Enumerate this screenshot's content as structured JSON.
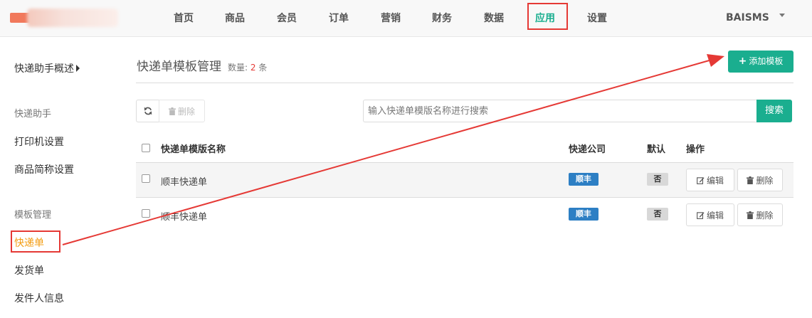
{
  "topnav": {
    "items": [
      "首页",
      "商品",
      "会员",
      "订单",
      "营销",
      "财务",
      "数据",
      "应用",
      "设置"
    ],
    "active_index": 7,
    "user": "BAISMS"
  },
  "sidebar": {
    "overview": "快递助手概述",
    "section1_title": "快递助手",
    "section1_items": [
      "打印机设置",
      "商品简称设置"
    ],
    "section2_title": "模板管理",
    "section2_items": [
      "快递单",
      "发货单",
      "发件人信息"
    ],
    "active_item": "快递单"
  },
  "main": {
    "title": "快递单模板管理",
    "count_label": "数量:",
    "count_value": "2",
    "count_unit": "条",
    "add_button": "添加模板",
    "delete_button": "删除",
    "search_placeholder": "输入快递单模版名称进行搜索",
    "search_value": "",
    "search_button": "搜索"
  },
  "table": {
    "headers": [
      "快递单模版名称",
      "快递公司",
      "默认",
      "操作"
    ],
    "rows": [
      {
        "name": "顺丰快递单",
        "company": "顺丰",
        "default": "否",
        "edit": "编辑",
        "delete": "删除"
      },
      {
        "name": "顺丰快递单",
        "company": "顺丰",
        "default": "否",
        "edit": "编辑",
        "delete": "删除"
      }
    ]
  },
  "colors": {
    "primary_green": "#1aae8f",
    "tag_blue": "#2d7fc4",
    "annotation_red": "#e53935",
    "active_orange": "#f39c12"
  }
}
